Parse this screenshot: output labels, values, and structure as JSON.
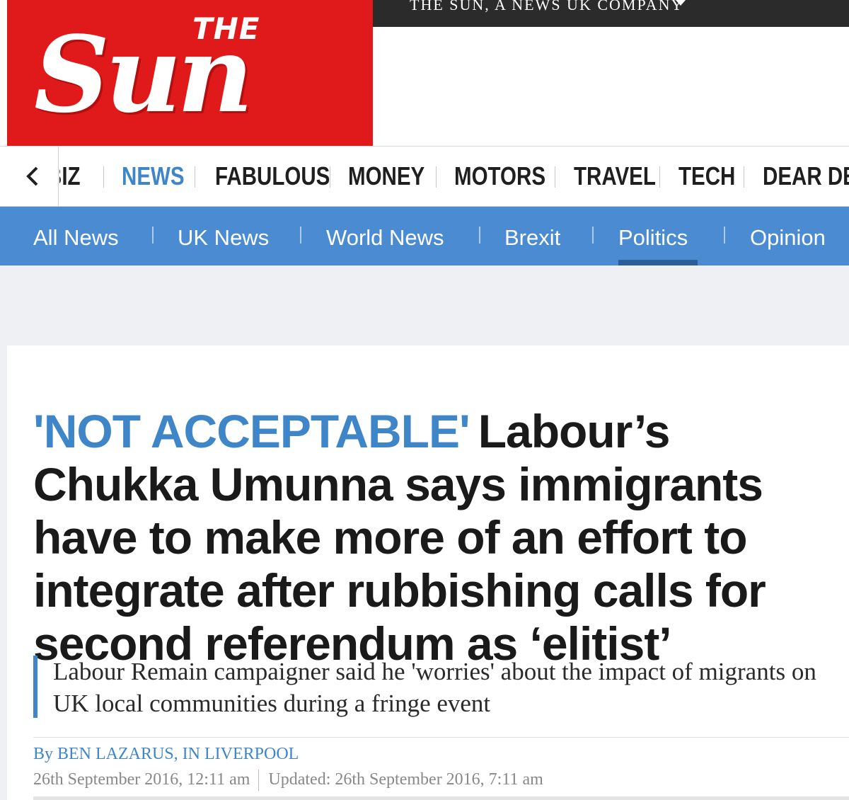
{
  "masthead": {
    "logo_top": "THE",
    "logo_main": "Sun",
    "company_label": "THE SUN, A NEWS UK COMPANY",
    "brand_red": "#e01a1a"
  },
  "section_nav": {
    "back_icon": "chevron-left-icon",
    "items": [
      {
        "label": "BIZ",
        "active": false
      },
      {
        "label": "NEWS",
        "active": true
      },
      {
        "label": "FABULOUS",
        "active": false
      },
      {
        "label": "MONEY",
        "active": false
      },
      {
        "label": "MOTORS",
        "active": false
      },
      {
        "label": "TRAVEL",
        "active": false
      },
      {
        "label": "TECH",
        "active": false
      },
      {
        "label": "DEAR DEIDRE",
        "active": false
      }
    ]
  },
  "sub_nav": {
    "background": "#4a8bd2",
    "items": [
      {
        "label": "All News",
        "active": false
      },
      {
        "label": "UK News",
        "active": false
      },
      {
        "label": "World News",
        "active": false
      },
      {
        "label": "Brexit",
        "active": false
      },
      {
        "label": "Politics",
        "active": true
      },
      {
        "label": "Opinion",
        "active": false
      }
    ]
  },
  "article": {
    "kicker": "'NOT ACCEPTABLE'",
    "headline": "Labour’s Chukka Umunna says immigrants have to make more of an effort to integrate after rubbishing calls for second referendum as ‘elitist’",
    "standfirst": "Labour Remain campaigner said he 'worries' about the impact of migrants on UK local communities during a fringe event",
    "byline": "By BEN LAZARUS, IN LIVERPOOL",
    "published": "26th September 2016, 12:11 am",
    "updated": "Updated: 26th September 2016, 7:11 am",
    "accent": "#3f86c8"
  }
}
